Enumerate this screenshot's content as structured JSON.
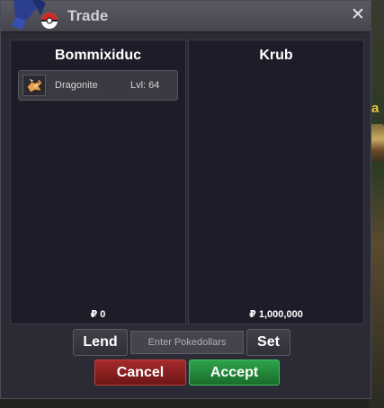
{
  "window": {
    "title": "Trade",
    "close_label": "✕"
  },
  "left_panel": {
    "player_name": "Bommixiduc",
    "pokemon": [
      {
        "name": "Dragonite",
        "level": "Lvl: 64"
      }
    ],
    "money": "₽ 0"
  },
  "right_panel": {
    "player_name": "Krub",
    "money": "₽ 1,000,000"
  },
  "controls": {
    "lend_label": "Lend",
    "pokedollars_placeholder": "Enter Pokedollars",
    "set_label": "Set",
    "cancel_label": "Cancel",
    "accept_label": "Accept"
  },
  "background": {
    "partial_text": "a"
  },
  "colors": {
    "cancel": "#8b1e1e",
    "accept": "#24893a",
    "panel": "#1d1d29"
  }
}
